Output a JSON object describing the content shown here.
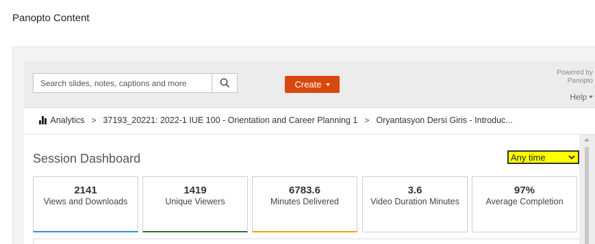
{
  "page": {
    "title": "Panopto Content"
  },
  "toolbar": {
    "search_placeholder": "Search slides, notes, captions and more",
    "search_value": "",
    "create_label": "Create",
    "powered_by": [
      "Powered by",
      "Panopto"
    ],
    "help_label": "Help"
  },
  "breadcrumb": [
    {
      "label": "Analytics",
      "icon": "bar-chart-icon"
    },
    {
      "label": "37193_20221: 2022-1 IUE 100 - Orientation and Career Planning 1"
    },
    {
      "label": "Oryantasyon Dersi Giris - Introduc..."
    }
  ],
  "dashboard": {
    "title": "Session Dashboard",
    "time_filter": "Any time",
    "time_filter_highlight": "#ffff00",
    "stats": [
      {
        "value": "2141",
        "label": "Views and Downloads",
        "accent": "#2f8ed8"
      },
      {
        "value": "1419",
        "label": "Unique Viewers",
        "accent": "#2e6b3a"
      },
      {
        "value": "6783.6",
        "label": "Minutes Delivered",
        "accent": "#f0a30a"
      },
      {
        "value": "3.6",
        "label": "Video Duration Minutes",
        "accent": ""
      },
      {
        "value": "97%",
        "label": "Average Completion",
        "accent": ""
      }
    ]
  },
  "colors": {
    "create_button": "#d9480f"
  }
}
